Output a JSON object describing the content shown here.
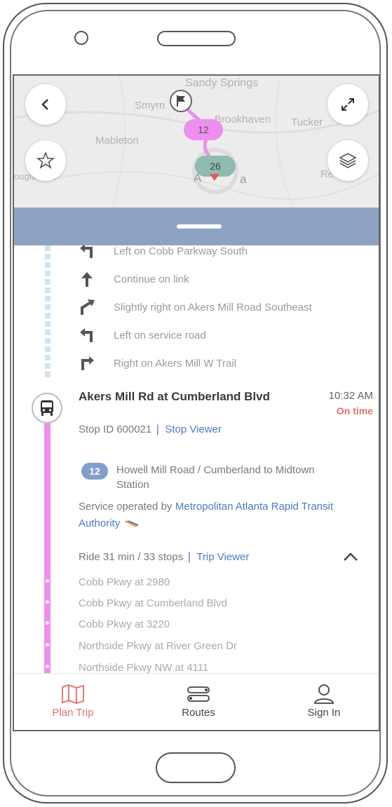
{
  "map": {
    "labels": [
      "Sandy Springs",
      "Smyrn",
      "Brookhaven",
      "Tucker",
      "Mableton",
      "ouglasville",
      "A",
      "a",
      "Re"
    ],
    "route_badges": [
      {
        "number": "12",
        "color": "#ee8ef0"
      },
      {
        "number": "26",
        "color": "#8fbbb1"
      }
    ]
  },
  "map_controls": {
    "back_icon": "chevron-left-icon",
    "expand_icon": "expand-icon",
    "favorite_icon": "star-icon",
    "layers_icon": "layers-icon"
  },
  "directions": [
    {
      "icon": "turn-left-icon",
      "text": "Left on Cobb Parkway South"
    },
    {
      "icon": "arrow-up-icon",
      "text": "Continue on link"
    },
    {
      "icon": "slight-right-icon",
      "text": "Slightly right on Akers Mill Road Southeast"
    },
    {
      "icon": "turn-left-icon",
      "text": "Left on service road"
    },
    {
      "icon": "turn-right-icon",
      "text": "Right on Akers Mill W Trail"
    }
  ],
  "stop": {
    "name": "Akers Mill Rd at Cumberland Blvd",
    "time": "10:32 AM",
    "status": "On time",
    "stop_id_label": "Stop ID 600021",
    "stop_viewer_link": "Stop Viewer"
  },
  "route": {
    "badge": "12",
    "badge_color": "#7fa0c9",
    "name_line1": "Howell Mill Road / Cumberland to Midtown",
    "name_line2": "Station",
    "operated_prefix": "Service operated by",
    "operator_line1": "Metropolitan Atlanta Rapid Transit",
    "operator_line2": "Authority",
    "ride_info": "Ride 31 min / 33 stops",
    "trip_viewer_link": "Trip Viewer"
  },
  "intermediate_stops": [
    "Cobb Pkwy at 2980",
    "Cobb Pkwy at Cumberland Blvd",
    "Cobb Pkwy at 3220",
    "Northside Pkwy at River Green Dr",
    "Northside Pkwy NW at 4111"
  ],
  "bottom_nav": [
    {
      "label": "Plan Trip",
      "icon": "map-icon",
      "active": true
    },
    {
      "label": "Routes",
      "icon": "routes-icon",
      "active": false
    },
    {
      "label": "Sign In",
      "icon": "user-icon",
      "active": false
    }
  ],
  "colors": {
    "accent": "#e0706a",
    "sheet_header": "#8ea3c4",
    "route_line": "#ee8ef0",
    "walk_line": "#cfe3f2",
    "link": "#4a7cc0"
  }
}
